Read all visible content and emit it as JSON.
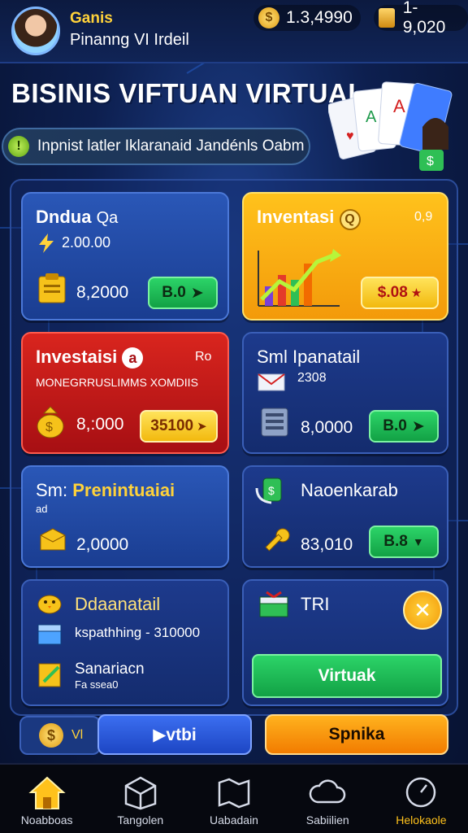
{
  "header": {
    "player_label": "Ganis",
    "player_sub": "Pinanng VI Irdeil",
    "coin_icon": "dollar-coin-icon",
    "coins": "1.3,4990",
    "gold_icon": "gold-bar-icon",
    "gold": "1-9,020"
  },
  "title": "BISINIS VIFTUAN VIRTUAL",
  "banner": {
    "icon_char": "!",
    "text": "Inpnist latler Iklaranaid Jandénls Oabm"
  },
  "cards": {
    "c1": {
      "title": "Dndua",
      "title_icon": "Qa",
      "rate": "2.00.00",
      "amount": "8,2000",
      "button": "B.0"
    },
    "c2": {
      "title": "Inventasi",
      "title_icon": "Q",
      "corner": "0,9",
      "button": "$.08"
    },
    "c3": {
      "title": "Investaisi",
      "title_icon": "a",
      "corner": "Ro",
      "subtitle": "MONEGRRUSLIMMS XOMDIIS",
      "amount": "8,:000",
      "button": "35100"
    },
    "c4": {
      "title": "Sml  Ipanatail",
      "rate": "2308",
      "amount": "8,0000",
      "button": "B.0"
    },
    "c5": {
      "title_a": "Sm:",
      "title_b": "Prenintuaiai",
      "sub": "ad",
      "amount": "2,0000"
    },
    "c6": {
      "title": "Naoenkarab",
      "amount": "83,010",
      "button": "B.8"
    },
    "c7": {
      "title": "Ddaanatail",
      "line2": "kspathhing - 310000",
      "line3": "Sanariacn",
      "line4": "Fa ssea0"
    },
    "c8": {
      "title": "TRI",
      "button": "Virtuak"
    }
  },
  "actions": {
    "coin_char": "$",
    "coin_label": "Vl",
    "play": "▶vtbi",
    "spin": "Spnika"
  },
  "nav": [
    {
      "label": "Noabboas",
      "icon": "home-icon"
    },
    {
      "label": "Tangolen",
      "icon": "box-icon"
    },
    {
      "label": "Uabadain",
      "icon": "map-icon"
    },
    {
      "label": "Sabiilien",
      "icon": "cloud-icon"
    },
    {
      "label": "Helokaole",
      "icon": "compass-icon"
    }
  ],
  "colors": {
    "accent_yellow": "#ffc21c",
    "green_button": "#12a145",
    "red_card": "#d9251e",
    "orange_card": "#f39a0a"
  }
}
